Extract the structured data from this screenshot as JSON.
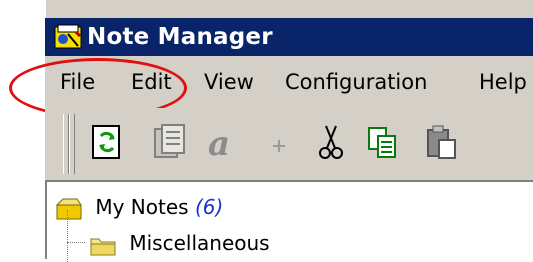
{
  "window": {
    "title": "Note Manager"
  },
  "menu": {
    "file": "File",
    "edit": "Edit",
    "view": "View",
    "configuration": "Configuration",
    "help": "Help"
  },
  "toolbar": {
    "buttons": [
      "refresh-icon",
      "notes-icon",
      "font-icon",
      "add-icon",
      "cut-icon",
      "copy-icon",
      "paste-icon"
    ]
  },
  "tree": {
    "root": {
      "label": "My Notes",
      "count": "(6)"
    },
    "children": [
      {
        "label": "Miscellaneous"
      }
    ]
  },
  "colors": {
    "titlebar": "#0a246a",
    "highlight_circle": "#e01010",
    "count_text": "#1a35cc"
  }
}
